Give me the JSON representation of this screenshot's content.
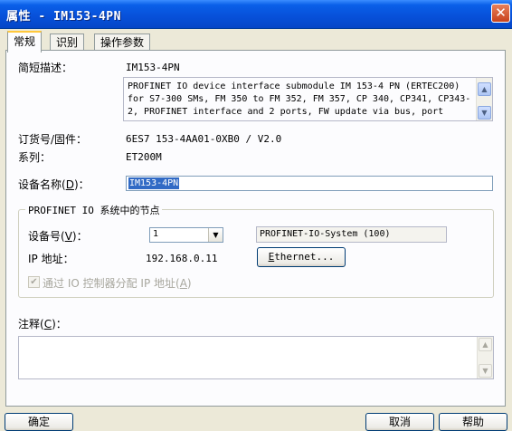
{
  "window": {
    "title": "属性 - IM153-4PN",
    "close_glyph": "✕"
  },
  "tabs": [
    {
      "label": "常规",
      "active": true
    },
    {
      "label": "识别",
      "active": false
    },
    {
      "label": "操作参数",
      "active": false
    }
  ],
  "general": {
    "short_desc_label": "简短描述：",
    "short_desc_value": "IM153-4PN",
    "description": "PROFINET IO device interface submodule IM 153-4 PN (ERTEC200)\nfor S7-300 SMs, FM 350 to FM 352, FM 357, CP 340, CP341, CP343-\n2, PROFINET interface and 2 ports, FW update via bus, port",
    "order_label": "订货号/固件：",
    "order_value": "6ES7 153-4AA01-0XB0 / V2.0",
    "family_label": "系列：",
    "family_value": "ET200M",
    "device_name_label_pre": "设备名称(",
    "device_name_label_key": "D",
    "device_name_label_post": ")：",
    "device_name_value": "IM153-4PN"
  },
  "node_group": {
    "title": "PROFINET IO 系统中的节点",
    "device_no_label_pre": "设备号(",
    "device_no_label_key": "V",
    "device_no_label_post": ")：",
    "device_no_value": "1",
    "system_value": "PROFINET-IO-System (100)",
    "ip_label": "IP 地址：",
    "ip_value": "192.168.0.11",
    "ethernet_button_key": "E",
    "ethernet_button_rest": "thernet...",
    "assign_ip_label_pre": "通过 IO 控制器分配 IP 地址(",
    "assign_ip_label_key": "A",
    "assign_ip_label_post": ")",
    "assign_ip_checked": true
  },
  "comments": {
    "label_pre": "注释(",
    "label_key": "C",
    "label_post": ")：",
    "value": ""
  },
  "footer": {
    "ok_label": "确定",
    "cancel_label": "取消",
    "help_label": "帮助"
  },
  "colors": {
    "titlebar": "#0750d9",
    "dialog_bg": "#ece9d8",
    "selection": "#316ac5"
  }
}
